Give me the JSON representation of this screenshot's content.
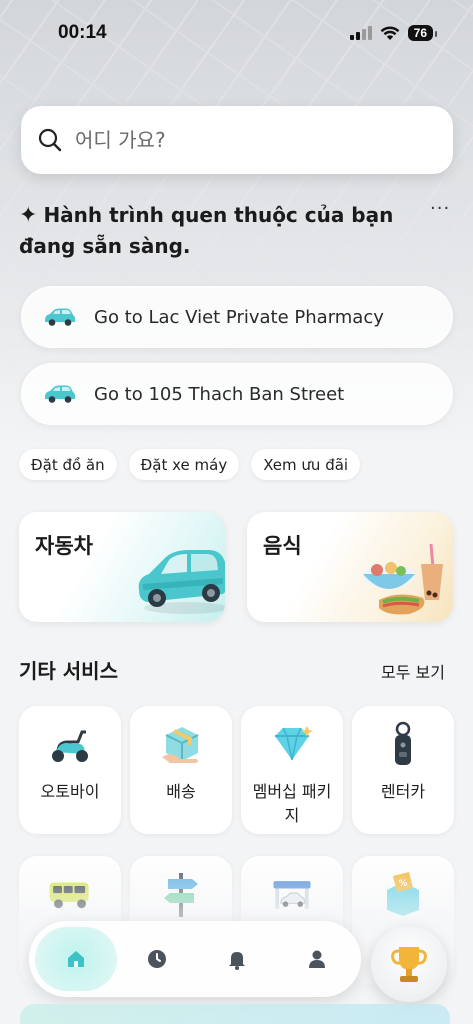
{
  "status_bar": {
    "time": "00:14",
    "battery": "76"
  },
  "search": {
    "placeholder": "어디 가요?"
  },
  "greeting": {
    "text": "Hành trình quen thuộc của bạn đang sẵn sàng.",
    "more": "···"
  },
  "routes": [
    {
      "label": "Go to Lac Viet Private Pharmacy"
    },
    {
      "label": "Go to 105 Thach Ban Street"
    }
  ],
  "chips": [
    {
      "label": "Đặt đồ ăn"
    },
    {
      "label": "Đặt xe máy"
    },
    {
      "label": "Xem ưu đãi"
    }
  ],
  "main_services": [
    {
      "label": "자동차",
      "icon": "car-icon"
    },
    {
      "label": "음식",
      "icon": "food-icon"
    }
  ],
  "other_services": {
    "title": "기타 서비스",
    "see_all": "모두 보기",
    "items": [
      {
        "label": "오토바이",
        "icon": "scooter-icon"
      },
      {
        "label": "배송",
        "icon": "package-icon"
      },
      {
        "label": "멤버십 패키지",
        "icon": "diamond-icon"
      },
      {
        "label": "렌터카",
        "icon": "car-key-icon"
      },
      {
        "label": "",
        "icon": "bus-icon"
      },
      {
        "label": "",
        "icon": "signpost-icon"
      },
      {
        "label": "",
        "icon": "car-wash-icon"
      },
      {
        "label": "",
        "icon": "discount-box-icon"
      }
    ]
  },
  "colors": {
    "accent": "#3cc3c6",
    "card_car_tint": "#c6efef",
    "card_food_tint": "#f7e3bc"
  }
}
